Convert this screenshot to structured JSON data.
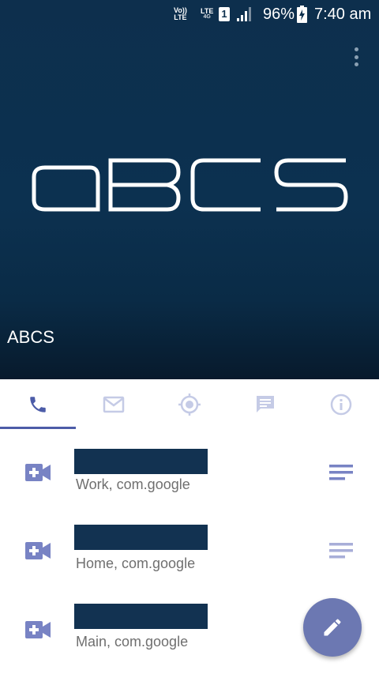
{
  "status_bar": {
    "volte_top": "Vo))",
    "volte_bottom": "LTE",
    "lte_top": "LTE",
    "lte_bottom": "4G",
    "sim": "1",
    "battery": "96%",
    "time": "7:40 am"
  },
  "header": {
    "logo_text": "ABCS",
    "contact_name": "ABCS"
  },
  "tabs": [
    {
      "icon": "phone-icon",
      "selected": true
    },
    {
      "icon": "mail-icon",
      "selected": false
    },
    {
      "icon": "location-icon",
      "selected": false
    },
    {
      "icon": "message-icon",
      "selected": false
    },
    {
      "icon": "info-icon",
      "selected": false
    }
  ],
  "entries": [
    {
      "subtitle": "Work,  com.google"
    },
    {
      "subtitle": "Home,  com.google"
    },
    {
      "subtitle": "Main,  com.google"
    }
  ],
  "colors": {
    "header_bg": "#0d2f4d",
    "accent": "#4c5ca8",
    "icon_active": "#7883c4",
    "icon_inactive": "#c5cbe6",
    "fab": "#6c78b2",
    "redacted": "#123251"
  }
}
